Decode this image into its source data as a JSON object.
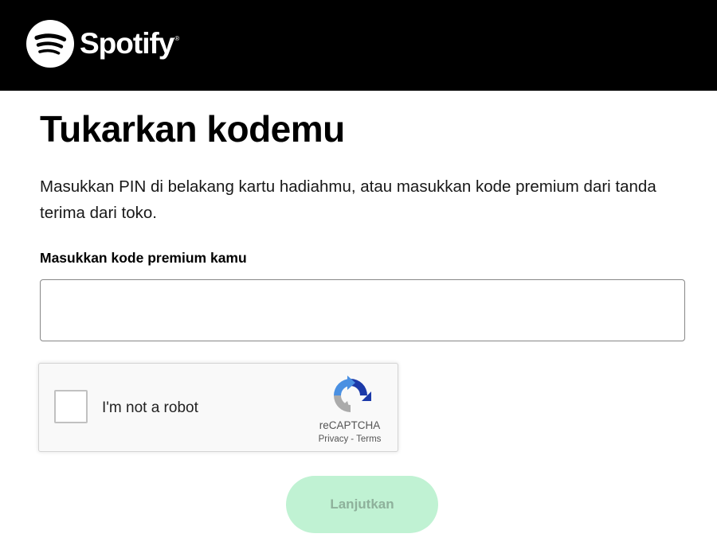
{
  "header": {
    "brand_name": "Spotify",
    "brand_reg": "®",
    "logo_icon": "spotify-logo-icon",
    "background": "#000000"
  },
  "main": {
    "title": "Tukarkan kodemu",
    "description": "Masukkan PIN di belakang kartu hadiahmu, atau masukkan kode premium dari tanda terima dari toko.",
    "field_label": "Masukkan kode premium kamu",
    "field_value": ""
  },
  "recaptcha": {
    "checkbox_label": "I'm not a robot",
    "brand": "reCAPTCHA",
    "privacy_label": "Privacy",
    "separator": "-",
    "terms_label": "Terms",
    "logo_icon": "recaptcha-logo-icon"
  },
  "actions": {
    "submit_label": "Lanjutkan",
    "submit_bg": "#c0f2d3",
    "submit_text_color": "#8eb19b"
  }
}
